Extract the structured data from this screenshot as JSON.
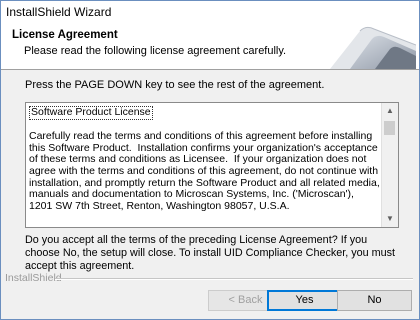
{
  "window": {
    "title": "InstallShield Wizard"
  },
  "header": {
    "title": "License Agreement",
    "subtitle": "Please read the following license agreement carefully."
  },
  "instruction": "Press the PAGE DOWN key to see the rest of the agreement.",
  "license": {
    "heading": "Software Product License",
    "body": "Carefully read the terms and conditions of this agreement before installing this Software Product.  Installation confirms your organization's acceptance of these terms and conditions as Licensee.  If your organization does not agree with the terms and conditions of this agreement, do not continue with installation, and promptly return the Software Product and all related media, manuals and documentation to Microscan Systems, Inc. ('Microscan'), 1201 SW 7th Street, Renton, Washington 98057, U.S.A."
  },
  "question": "Do you accept all the terms of the preceding License Agreement?  If you choose No,  the setup will close.  To install UID Compliance Checker, you must accept this agreement.",
  "brand": "InstallShield",
  "buttons": {
    "back": "< Back",
    "yes": "Yes",
    "no": "No"
  },
  "icons": {
    "scroll_up": "chevron-up-icon",
    "scroll_down": "chevron-down-icon"
  },
  "colors": {
    "accent": "#0078d7",
    "header_bg": "#ffffff",
    "dialog_bg": "#f0f0f0"
  }
}
